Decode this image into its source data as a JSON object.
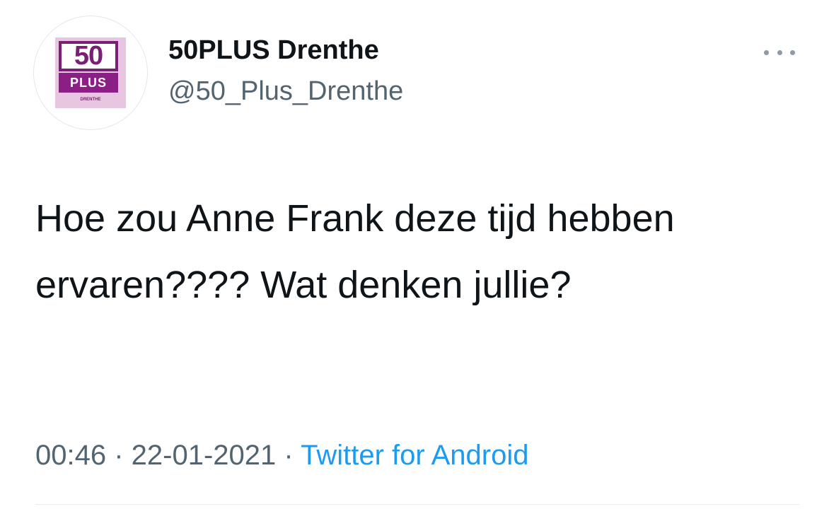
{
  "author": {
    "display_name": "50PLUS Drenthe",
    "handle": "@50_Plus_Drenthe",
    "avatar": {
      "logo_top": "50",
      "logo_bottom": "PLUS",
      "logo_region": "DRENTHE",
      "brand_color": "#7a1f75",
      "bg_color": "#e8c6e2"
    }
  },
  "menu": {
    "icon": "more-horizontal-icon"
  },
  "tweet": {
    "text": "Hoe zou Anne Frank deze tijd hebben ervaren???? Wat denken jullie?"
  },
  "meta": {
    "time": "00:46",
    "separator": " · ",
    "date": "22-01-2021",
    "source": "Twitter for Android",
    "source_color": "#1d9bf0"
  }
}
